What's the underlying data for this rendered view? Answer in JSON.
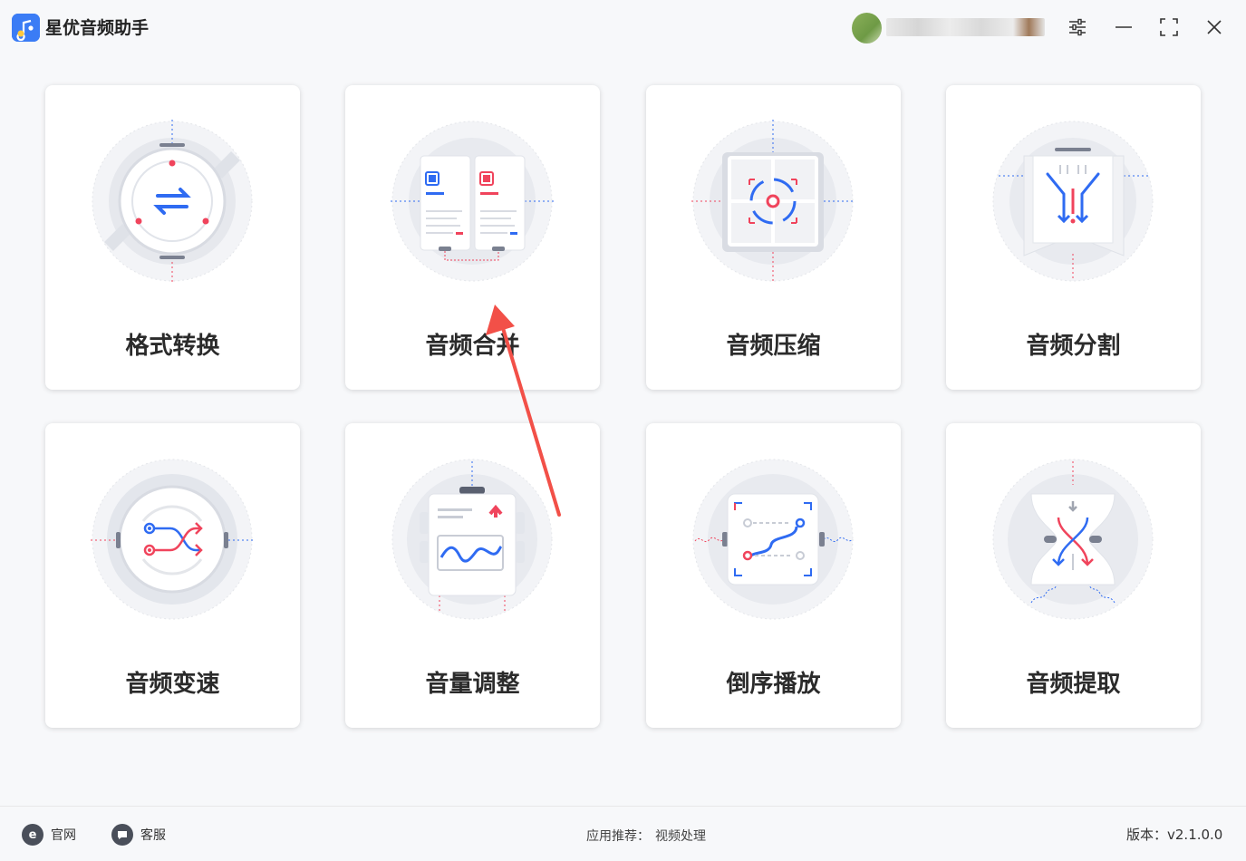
{
  "app": {
    "title": "星优音频助手"
  },
  "tools": [
    {
      "label": "格式转换",
      "icon": "format-convert-icon"
    },
    {
      "label": "音频合并",
      "icon": "audio-merge-icon"
    },
    {
      "label": "音频压缩",
      "icon": "audio-compress-icon"
    },
    {
      "label": "音频分割",
      "icon": "audio-split-icon"
    },
    {
      "label": "音频变速",
      "icon": "audio-speed-icon"
    },
    {
      "label": "音量调整",
      "icon": "volume-adjust-icon"
    },
    {
      "label": "倒序播放",
      "icon": "reverse-play-icon"
    },
    {
      "label": "音频提取",
      "icon": "audio-extract-icon"
    }
  ],
  "footer": {
    "site_label": "官网",
    "service_label": "客服",
    "recommend_label": "应用推荐：",
    "recommend_link": "视频处理",
    "version": "版本：v2.1.0.0"
  },
  "colors": {
    "accent_blue": "#2f6bf2",
    "accent_red": "#f0445c",
    "annotation_red": "#f25048"
  }
}
